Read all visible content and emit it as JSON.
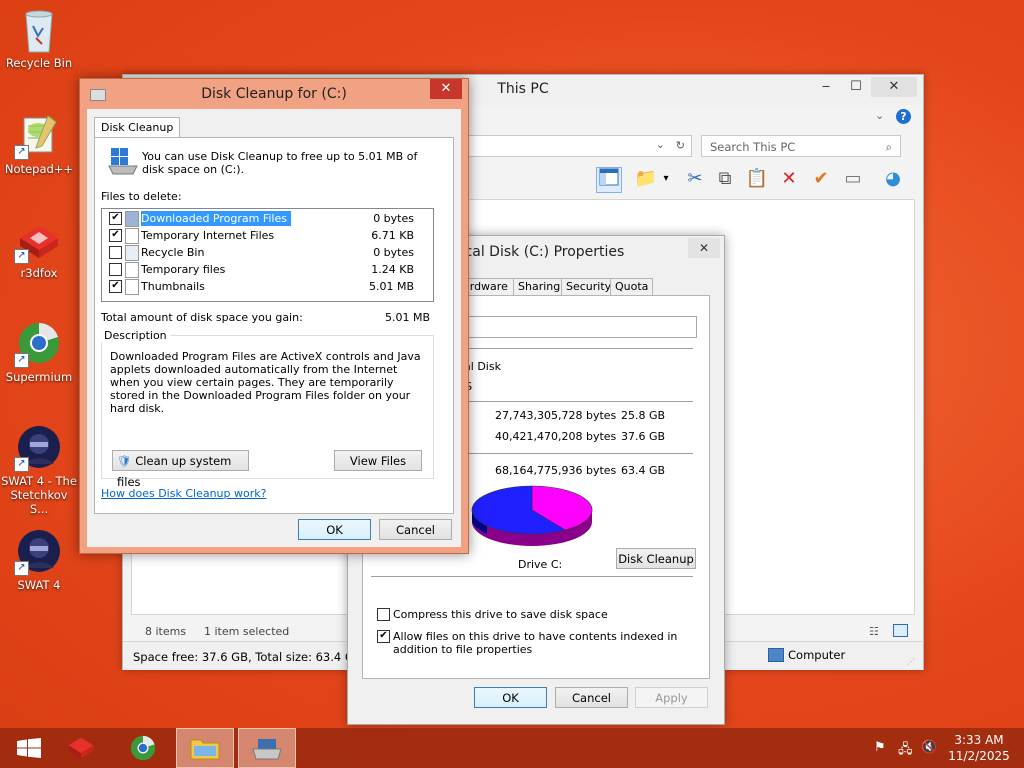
{
  "desktop": {
    "icons": [
      {
        "label": "Recycle Bin"
      },
      {
        "label": "Notepad++"
      },
      {
        "label": "r3dfox"
      },
      {
        "label": "Supermium"
      },
      {
        "label": "SWAT 4 - The Stetchkov S..."
      },
      {
        "label": "SWAT 4"
      }
    ]
  },
  "explorer": {
    "title": "This PC",
    "search_placeholder": "Search This PC",
    "status_items": "8 items",
    "status_selected": "1 item selected",
    "space_info": "Space free: 37.6 GB, Total size: 63.4 GB",
    "computer_label": "Computer"
  },
  "properties": {
    "title": "Local Disk (C:) Properties",
    "title_visible": "ocal Disk (C:) Properties",
    "tabs": [
      "ardware",
      "Sharing",
      "Security",
      "Quota"
    ],
    "type_value": "cal Disk",
    "fs_value": "FS",
    "used_bytes": "27,743,305,728 bytes",
    "used_gb": "25.8 GB",
    "free_bytes": "40,421,470,208 bytes",
    "free_gb": "37.6 GB",
    "capacity_bytes": "68,164,775,936 bytes",
    "capacity_gb": "63.4 GB",
    "drive_label": "Drive C:",
    "disk_cleanup_button": "Disk Cleanup",
    "compress_label": "Compress this drive to save disk space",
    "compress_checked": false,
    "index_label": "Allow files on this drive to have contents indexed in addition to file properties",
    "index_checked": true,
    "ok_button": "OK",
    "cancel_button": "Cancel",
    "apply_button": "Apply",
    "pie": {
      "used_fraction": 0.407,
      "used_color": "#ff00ff",
      "free_color": "#1f1fff"
    }
  },
  "cleanup": {
    "title": "Disk Cleanup for  (C:)",
    "tab": "Disk Cleanup",
    "intro": "You can use Disk Cleanup to free up to 5.01 MB of disk space on  (C:).",
    "files_label": "Files to delete:",
    "files": [
      {
        "name": "Downloaded Program Files",
        "size": "0 bytes",
        "checked": true,
        "selected": true
      },
      {
        "name": "Temporary Internet Files",
        "size": "6.71 KB",
        "checked": true,
        "selected": false
      },
      {
        "name": "Recycle Bin",
        "size": "0 bytes",
        "checked": false,
        "selected": false
      },
      {
        "name": "Temporary files",
        "size": "1.24 KB",
        "checked": false,
        "selected": false
      },
      {
        "name": "Thumbnails",
        "size": "5.01 MB",
        "checked": true,
        "selected": false
      }
    ],
    "total_label": "Total amount of disk space you gain:",
    "total_value": "5.01 MB",
    "description_legend": "Description",
    "description_text": "Downloaded Program Files are ActiveX controls and Java applets downloaded automatically from the Internet when you view certain pages. They are temporarily stored in the Downloaded Program Files folder on your hard disk.",
    "clean_system_button": "Clean up system files",
    "view_files_button": "View Files",
    "help_link": "How does Disk Cleanup work?",
    "ok_button": "OK",
    "cancel_button": "Cancel"
  },
  "taskbar": {
    "time": "3:33 AM",
    "date": "11/2/2025"
  }
}
